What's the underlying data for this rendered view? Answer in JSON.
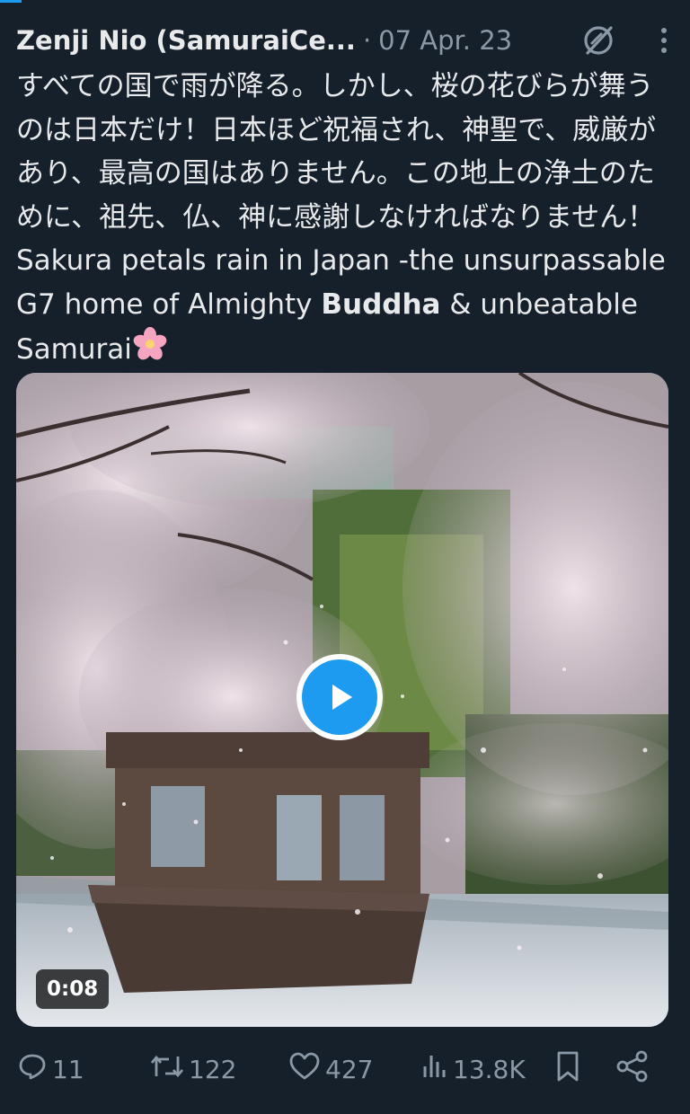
{
  "tweet": {
    "author_name": "Zenji Nio (SamuraiCe...",
    "separator": "·",
    "date": "07 Apr. 23",
    "body": {
      "ja": "すべての国で雨が降る。しかし、桜の花びらが舞うのは日本だけ！日本ほど祝福され、神聖で、威厳があり、最高の国はありません。この地上の浄土のために、祖先、仏、神に感謝しなければなりません！",
      "en_before": " Sakura petals rain in Japan -the unsurpassable G7 home of Almighty ",
      "en_bold": "Buddha",
      "en_after": " & unbeatable Samurai"
    },
    "media": {
      "duration": "0:08"
    },
    "stats": {
      "replies": "11",
      "reposts": "122",
      "likes": "427",
      "views": "13.8K"
    }
  },
  "icons": {
    "grok": "grok-icon",
    "more": "more-vertical-icon",
    "emoji": "cherry-blossom-icon",
    "play": "play-icon",
    "reply": "reply-icon",
    "repost": "repost-icon",
    "like": "like-icon",
    "views": "views-icon",
    "bookmark": "bookmark-icon",
    "share": "share-icon"
  },
  "colors": {
    "background": "#15202b",
    "text": "#e7e9ea",
    "secondary": "#8b98a5",
    "accent": "#1d9bf0"
  }
}
